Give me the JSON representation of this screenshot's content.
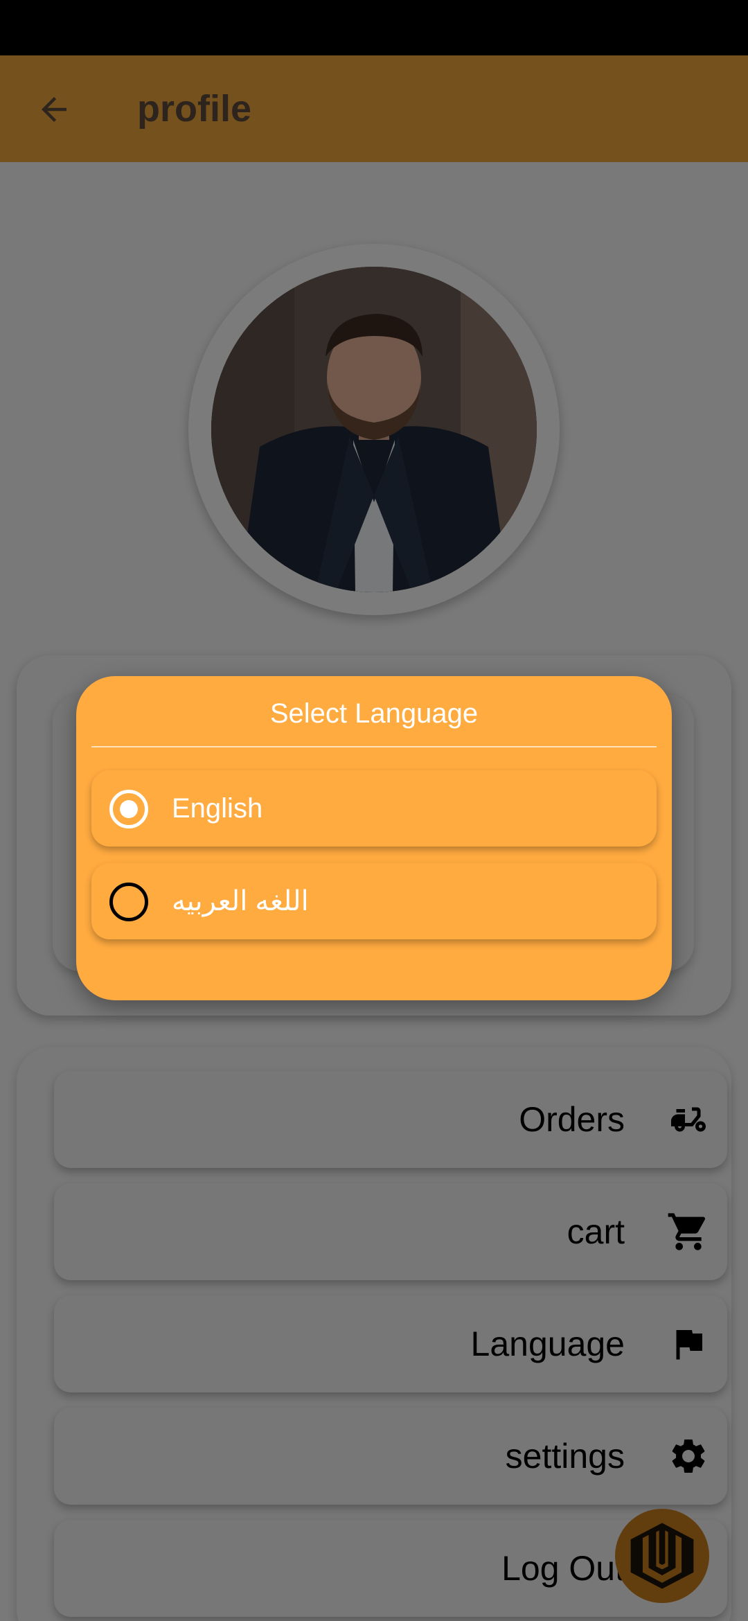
{
  "app_bar": {
    "title": "profile",
    "back_icon": "arrow-back-icon"
  },
  "menu": {
    "items": [
      {
        "label": "Orders",
        "icon": "delivery-scooter-icon"
      },
      {
        "label": "cart",
        "icon": "shopping-cart-icon"
      },
      {
        "label": "Language",
        "icon": "flag-icon"
      },
      {
        "label": "settings",
        "icon": "gear-icon"
      },
      {
        "label": "Log Out",
        "icon": "logout-icon"
      }
    ]
  },
  "dialog": {
    "title": "Select Language",
    "options": [
      {
        "label": "English",
        "selected": true
      },
      {
        "label": "اللغه العربيه",
        "selected": false
      }
    ]
  },
  "colors": {
    "accent": "#ffab40",
    "app_bar": "#eba33c",
    "fab": "#c47a1a"
  }
}
